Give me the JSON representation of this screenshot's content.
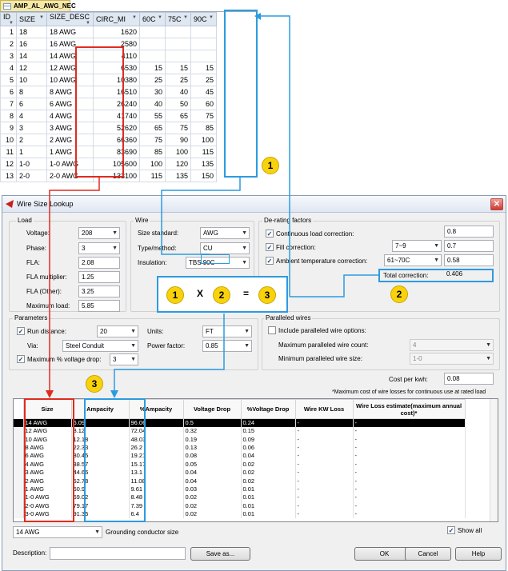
{
  "table": {
    "title": "AMP_AL_AWG_NEC",
    "columns": [
      "ID",
      "SIZE",
      "SIZE_DESC",
      "CIRC_MI",
      "60C",
      "75C",
      "90C"
    ],
    "rows": [
      [
        "1",
        "18",
        "18 AWG",
        "1620",
        "",
        "",
        ""
      ],
      [
        "2",
        "16",
        "16 AWG",
        "2580",
        "",
        "",
        ""
      ],
      [
        "3",
        "14",
        "14 AWG",
        "4110",
        "",
        "",
        ""
      ],
      [
        "4",
        "12",
        "12 AWG",
        "6530",
        "15",
        "15",
        "15"
      ],
      [
        "5",
        "10",
        "10 AWG",
        "10380",
        "25",
        "25",
        "25"
      ],
      [
        "6",
        "8",
        "8 AWG",
        "16510",
        "30",
        "40",
        "45"
      ],
      [
        "7",
        "6",
        "6 AWG",
        "26240",
        "40",
        "50",
        "60"
      ],
      [
        "8",
        "4",
        "4 AWG",
        "41740",
        "55",
        "65",
        "75"
      ],
      [
        "9",
        "3",
        "3 AWG",
        "52620",
        "65",
        "75",
        "85"
      ],
      [
        "10",
        "2",
        "2 AWG",
        "66360",
        "75",
        "90",
        "100"
      ],
      [
        "11",
        "1",
        "1 AWG",
        "83690",
        "85",
        "100",
        "115"
      ],
      [
        "12",
        "1-0",
        "1-0 AWG",
        "105600",
        "100",
        "120",
        "135"
      ],
      [
        "13",
        "2-0",
        "2-0 AWG",
        "133100",
        "115",
        "135",
        "150"
      ]
    ]
  },
  "dialog": {
    "title": "Wire Size Lookup",
    "load": {
      "group": "Load",
      "voltage_label": "Voltage:",
      "voltage": "208",
      "phase_label": "Phase:",
      "phase": "3",
      "fla_label": "FLA:",
      "fla": "2.08",
      "fla_mult_label": "FLA multiplier:",
      "fla_mult": "1.25",
      "fla_other_label": "FLA (Other):",
      "fla_other": "3.25",
      "max_load_label": "Maximum load:",
      "max_load": "5.85"
    },
    "wire": {
      "group": "Wire",
      "std_label": "Size standard:",
      "std": "AWG",
      "type_label": "Type/method:",
      "type": "CU",
      "ins_label": "Insulation:",
      "ins_prefix": "TBS",
      "ins": "90C"
    },
    "derating": {
      "group": "De-rating factors",
      "cont_label": "Continuous load correction:",
      "cont": "0.8",
      "fill_label": "Fill correction:",
      "fill_sel": "7~9",
      "fill": "0.7",
      "amb_label": "Ambient temperature correction:",
      "amb_sel": "61~70C",
      "amb": "0.58",
      "total_label": "Total correction:",
      "total": "0.406"
    },
    "parameters": {
      "group": "Parameters",
      "run_label": "Run distance:",
      "run": "20",
      "units_label": "Units:",
      "units": "FT",
      "via_label": "Via:",
      "via": "Steel Conduit",
      "pf_label": "Power factor:",
      "pf": "0.85",
      "vd_label": "Maximum % voltage drop:",
      "vd": "3"
    },
    "paralleled": {
      "group": "Paralleled wires",
      "include_label": "Include paralleled wire options:",
      "count_label": "Maximum paralleled wire count:",
      "count": "4",
      "min_label": "Minimum paralleled wire size:",
      "min": "1-0"
    },
    "cost_label": "Cost per kwh:",
    "cost": "0.08",
    "cost_note": "*Maximum cost of wire losses for continuous use at rated load",
    "grid": {
      "headers": [
        "Size",
        "Ampacity",
        "%Ampacity",
        "Voltage Drop",
        "%Voltage Drop",
        "Wire KW Loss",
        "Wire Loss estimate(maximum annual cost)*"
      ],
      "rows": [
        [
          "14 AWG",
          "6.09",
          "96.06",
          "0.5",
          "0.24",
          "-",
          "-"
        ],
        [
          "12 AWG",
          "8.12",
          "72.04",
          "0.32",
          "0.15",
          "-",
          "-"
        ],
        [
          "10 AWG",
          "12.18",
          "48.03",
          "0.19",
          "0.09",
          "-",
          "-"
        ],
        [
          "8 AWG",
          "22.33",
          "26.2",
          "0.13",
          "0.06",
          "-",
          "-"
        ],
        [
          "6 AWG",
          "30.45",
          "19.21",
          "0.08",
          "0.04",
          "-",
          "-"
        ],
        [
          "4 AWG",
          "38.57",
          "15.17",
          "0.05",
          "0.02",
          "-",
          "-"
        ],
        [
          "3 AWG",
          "44.66",
          "13.1",
          "0.04",
          "0.02",
          "-",
          "-"
        ],
        [
          "2 AWG",
          "52.78",
          "11.08",
          "0.04",
          "0.02",
          "-",
          "-"
        ],
        [
          "1 AWG",
          "60.9",
          "9.61",
          "0.03",
          "0.01",
          "-",
          "-"
        ],
        [
          "1-0 AWG",
          "69.02",
          "8.48",
          "0.02",
          "0.01",
          "-",
          "-"
        ],
        [
          "2-0 AWG",
          "79.17",
          "7.39",
          "0.02",
          "0.01",
          "-",
          "-"
        ],
        [
          "3-0 AWG",
          "91.35",
          "6.4",
          "0.02",
          "0.01",
          "-",
          "-"
        ]
      ]
    },
    "ground_sel": "14 AWG",
    "ground_label": "Grounding conductor size",
    "show_all": "Show all",
    "desc_label": "Description:",
    "save_as": "Save as...",
    "ok": "OK",
    "cancel": "Cancel",
    "help": "Help"
  },
  "annotations": {
    "c1": "1",
    "c2": "2",
    "c3": "3",
    "x": "X",
    "eq": "="
  },
  "colors": {
    "red": "#e02b20",
    "blue": "#2c9be0",
    "yellow": "#f8d20c"
  }
}
